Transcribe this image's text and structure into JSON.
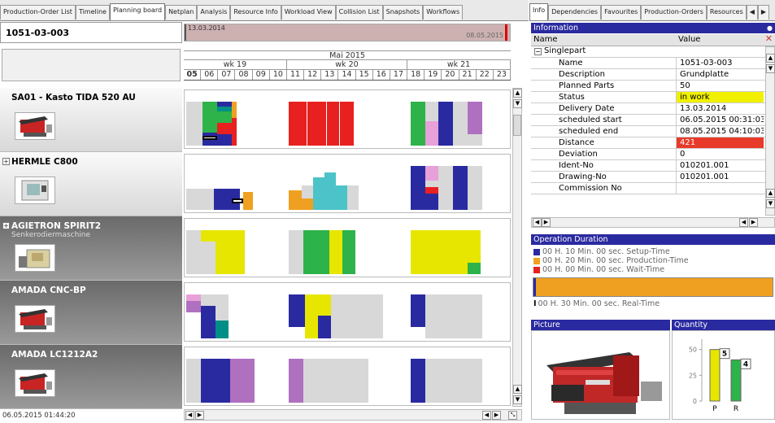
{
  "left_tabs": [
    "Production-Order List",
    "Timeline",
    "Planning board",
    "Netplan",
    "Analysis",
    "Resource Info",
    "Workload View",
    "Collision List",
    "Snapshots",
    "Workflows"
  ],
  "left_active_tab": "Planning board",
  "right_tabs": [
    "Info",
    "Dependencies",
    "Favourites",
    "Production-Orders",
    "Resources"
  ],
  "right_active_tab": "Info",
  "order_id": "1051-03-003",
  "timeline": {
    "start_date": "13.03.2014",
    "end_date": "08.05.2015",
    "marker_fraction": 0.995
  },
  "calendar": {
    "month": "Mai 2015",
    "weeks": [
      "wk 19",
      "wk 20",
      "wk 21"
    ],
    "days": [
      "05",
      "06",
      "07",
      "08",
      "09",
      "10",
      "11",
      "12",
      "13",
      "14",
      "15",
      "16",
      "17",
      "18",
      "19",
      "20",
      "21",
      "22",
      "23"
    ]
  },
  "resources": [
    {
      "name": "SA01 - Kasto TIDA 520 AU",
      "subtitle": "",
      "expandable": false,
      "dark": false,
      "icon": "bandsaw-machine-icon"
    },
    {
      "name": "HERMLE C800",
      "subtitle": "",
      "expandable": true,
      "dark": false,
      "icon": "cnc-mill-machine-icon"
    },
    {
      "name": "AGIETRON SPIRIT2",
      "subtitle": "Senkerodiermaschine",
      "expandable": true,
      "dark": true,
      "icon": "edm-machine-icon"
    },
    {
      "name": "AMADA CNC-BP",
      "subtitle": "",
      "expandable": false,
      "dark": true,
      "icon": "bandsaw-machine-icon"
    },
    {
      "name": "AMADA LC1212A2",
      "subtitle": "",
      "expandable": false,
      "dark": true,
      "icon": "bandsaw-machine-icon"
    }
  ],
  "footer_timestamp": "06.05.2015 01:44:20",
  "colors": {
    "green": "#2db34a",
    "red": "#e82020",
    "yellow": "#e6e600",
    "navy": "#2a2aa0",
    "teal": "#4cc3c8",
    "orange": "#f0a020",
    "purple": "#b070c0",
    "pink": "#e7a0d8",
    "gray": "#d8d8d8",
    "teal2": "#008f86"
  },
  "info": {
    "panel_title": "Information",
    "col_name": "Name",
    "col_value": "Value",
    "group": "Singlepart",
    "rows": [
      {
        "name": "Name",
        "value": "1051-03-003",
        "highlight": ""
      },
      {
        "name": "Description",
        "value": "Grundplatte",
        "highlight": ""
      },
      {
        "name": "Planned Parts",
        "value": "50",
        "highlight": ""
      },
      {
        "name": "Status",
        "value": "in work",
        "highlight": "yellow"
      },
      {
        "name": "Delivery Date",
        "value": "13.03.2014",
        "highlight": ""
      },
      {
        "name": "scheduled start",
        "value": "06.05.2015 00:31:03",
        "highlight": ""
      },
      {
        "name": "scheduled end",
        "value": "08.05.2015 04:10:03",
        "highlight": ""
      },
      {
        "name": "Distance",
        "value": "421",
        "highlight": "red"
      },
      {
        "name": "Deviation",
        "value": "0",
        "highlight": ""
      },
      {
        "name": "Ident-No",
        "value": "010201.001",
        "highlight": ""
      },
      {
        "name": "Drawing-No",
        "value": "010201.001",
        "highlight": ""
      },
      {
        "name": "Commission No",
        "value": "",
        "highlight": ""
      }
    ]
  },
  "operation_duration": {
    "title": "Operation Duration",
    "legend": [
      {
        "label": "00 H. 10 Min. 00 sec. Setup-Time",
        "color": "#2a2aa0"
      },
      {
        "label": "00 H. 20 Min. 00 sec. Production-Time",
        "color": "#f0a020"
      },
      {
        "label": "00 H. 00 Min. 00 sec. Wait-Time",
        "color": "#e82020"
      }
    ],
    "realtime_label": "00 H. 30 Min. 00 sec. Real-Time",
    "setup_fraction": 0.01
  },
  "picture": {
    "title": "Picture",
    "icon": "bandsaw-machine-icon"
  },
  "quantity": {
    "title": "Quantity",
    "max": 60,
    "ticks": [
      50,
      25,
      0
    ],
    "bars": [
      {
        "label": "P",
        "value": 50,
        "data_label": "5",
        "color": "#e6e600"
      },
      {
        "label": "R",
        "value": 40,
        "data_label": "4",
        "color": "#2db34a"
      }
    ]
  }
}
